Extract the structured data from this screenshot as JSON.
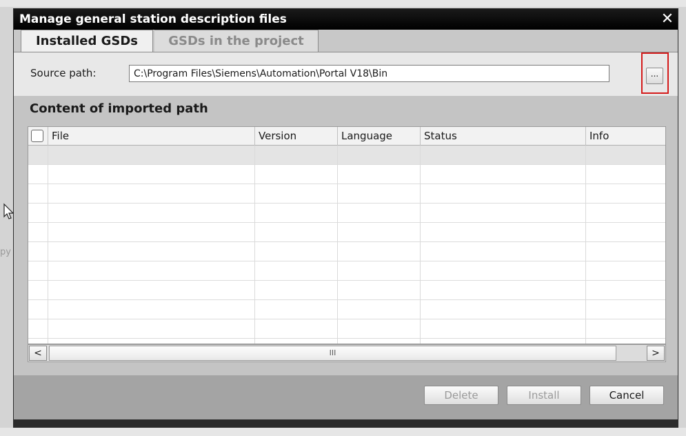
{
  "background": {
    "partial_text": "py"
  },
  "dialog": {
    "title": "Manage general station description files",
    "close_glyph": "✕",
    "tabs": [
      {
        "label": "Installed GSDs",
        "active": true
      },
      {
        "label": "GSDs in the project",
        "active": false
      }
    ],
    "source": {
      "label": "Source path:",
      "value": "C:\\Program Files\\Siemens\\Automation\\Portal V18\\Bin",
      "browse_label": "..."
    },
    "content": {
      "title": "Content of imported path",
      "columns": [
        "File",
        "Version",
        "Language",
        "Status",
        "Info"
      ],
      "rows": []
    },
    "scrollbar": {
      "left": "<",
      "right": ">",
      "thumb_grip": "III"
    },
    "buttons": {
      "delete": "Delete",
      "install": "Install",
      "cancel": "Cancel"
    }
  },
  "colors": {
    "highlight": "#d41a1a",
    "titlebar": "#000000"
  }
}
